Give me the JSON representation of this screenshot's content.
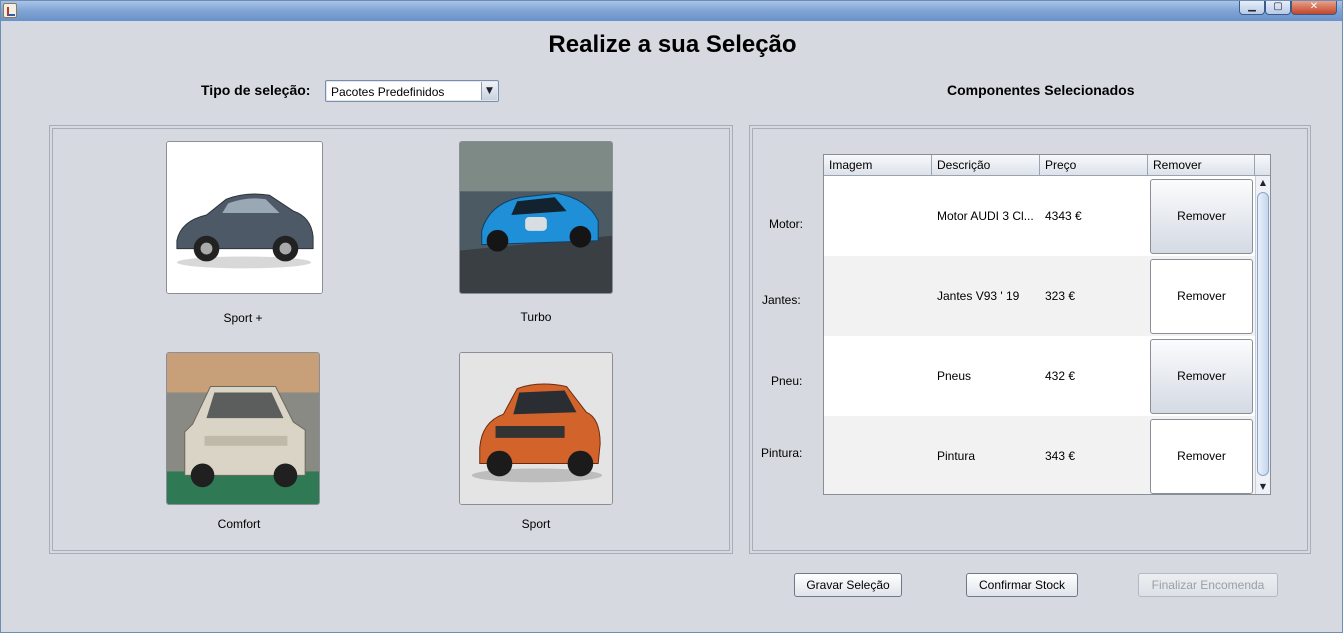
{
  "window": {
    "controls": {
      "minimize": "▁",
      "maximize": "▢",
      "close": "✕"
    }
  },
  "heading": "Realize a sua Seleção",
  "selection": {
    "label": "Tipo de seleção:",
    "value": "Pacotes Predefinidos"
  },
  "components_title": "Componentes Selecionados",
  "packages": [
    {
      "label": "Sport +",
      "color": "#4d5966"
    },
    {
      "label": "Turbo",
      "color": "#1f8fd8"
    },
    {
      "label": "Comfort",
      "color": "#d9d4c5"
    },
    {
      "label": "Sport",
      "color": "#d2642b"
    }
  ],
  "table": {
    "columns": [
      "Imagem",
      "Descrição",
      "Preço",
      "Remover"
    ],
    "rows": [
      {
        "row_label": "Motor:",
        "description": "Motor AUDI 3 Cl...",
        "price": "4343 €",
        "remove": "Remover"
      },
      {
        "row_label": "Jantes:",
        "description": "Jantes V93 ' 19",
        "price": "323 €",
        "remove": "Remover"
      },
      {
        "row_label": "Pneu:",
        "description": "Pneus",
        "price": "432 €",
        "remove": "Remover"
      },
      {
        "row_label": "Pintura:",
        "description": "Pintura",
        "price": "343 €",
        "remove": "Remover"
      }
    ]
  },
  "buttons": {
    "save": "Gravar Seleção",
    "confirm": "Confirmar Stock",
    "finalize": "Finalizar Encomenda"
  }
}
